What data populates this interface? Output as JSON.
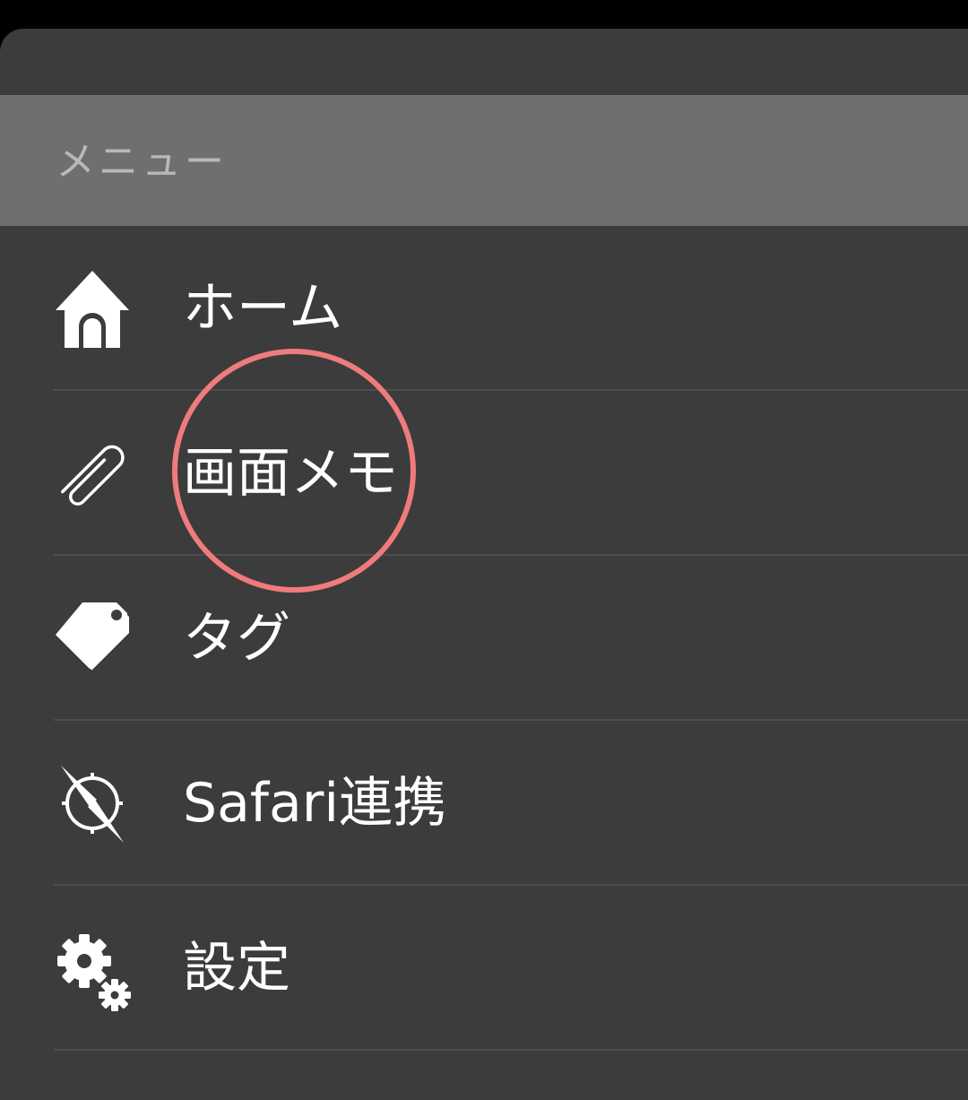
{
  "menu": {
    "header": "メニュー",
    "items": [
      {
        "label": "ホーム",
        "icon": "home-icon"
      },
      {
        "label": "画面メモ",
        "icon": "paperclip-icon"
      },
      {
        "label": "タグ",
        "icon": "tag-icon"
      },
      {
        "label": "Safari連携",
        "icon": "compass-icon"
      },
      {
        "label": "設定",
        "icon": "gear-icon"
      }
    ]
  },
  "colors": {
    "panel_background": "#3c3c3c",
    "header_background": "#6f6f6f",
    "header_text": "#b9b9b9",
    "item_text": "#ffffff",
    "highlight": "#f07b7b"
  }
}
